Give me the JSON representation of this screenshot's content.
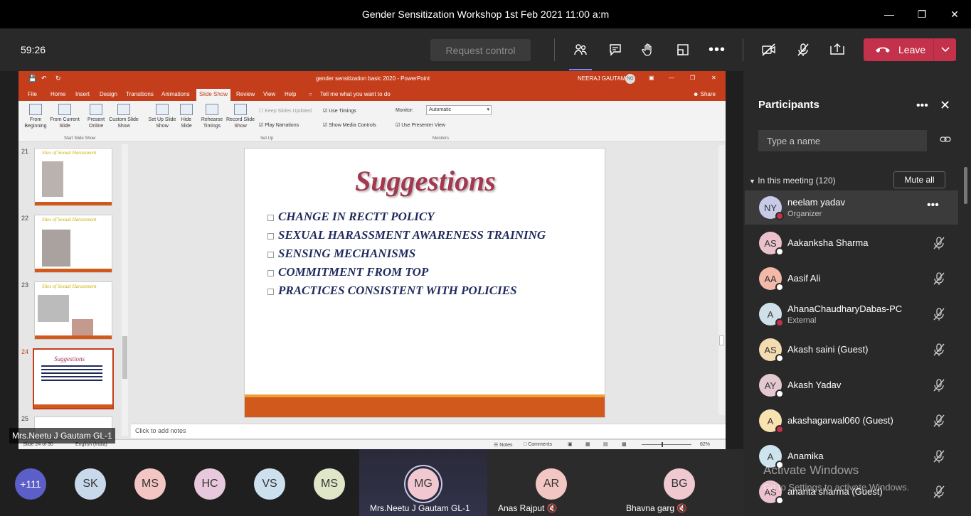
{
  "window": {
    "title": "Gender Sensitization Workshop 1st Feb 2021 11:00 a:m"
  },
  "toolbar": {
    "timer": "59:26",
    "request_control": "Request control",
    "leave": "Leave"
  },
  "powerpoint": {
    "doc_title": "gender sensitization basic 2020  -  PowerPoint",
    "user": "NEERAJ GAUTAM",
    "user_initials": "NG",
    "tabs": [
      "File",
      "Home",
      "Insert",
      "Design",
      "Transitions",
      "Animations",
      "Slide Show",
      "Review",
      "View",
      "Help"
    ],
    "tell_me": "Tell me what you want to do",
    "share": "Share",
    "ribbon": {
      "from_beginning": "From Beginning",
      "from_current": "From Current Slide",
      "present_online": "Present Online",
      "custom_show": "Custom Slide Show",
      "group_start": "Start Slide Show",
      "setup": "Set Up Slide Show",
      "hide": "Hide Slide",
      "rehearse": "Rehearse Timings",
      "record": "Record Slide Show",
      "keep_updated": "Keep Slides Updated",
      "play_narrations": "Play Narrations",
      "use_timings": "Use Timings",
      "show_media": "Show Media Controls",
      "group_setup": "Set Up",
      "monitor_label": "Monitor:",
      "monitor_value": "Automatic",
      "presenter_view": "Use Presenter View",
      "group_monitors": "Monitors"
    },
    "thumbnails": [
      {
        "num": "21",
        "title": "Sites of Sexual Harassment"
      },
      {
        "num": "22",
        "title": "Sites of Sexual Harassment"
      },
      {
        "num": "23",
        "title": "Sites of Sexual Harassment"
      },
      {
        "num": "24",
        "title": "Suggestions"
      },
      {
        "num": "25",
        "title": ""
      }
    ],
    "slide": {
      "title": "Suggestions",
      "bullets": [
        "CHANGE IN RECTT POLICY",
        "SEXUAL HARASSMENT AWARENESS TRAINING",
        "SENSING MECHANISMS",
        "COMMITMENT FROM TOP",
        "PRACTICES CONSISTENT WITH POLICIES"
      ]
    },
    "notes_placeholder": "Click to add notes",
    "status": {
      "slide": "Slide 24 of 30",
      "lang": "English (India)",
      "notes": "Notes",
      "comments": "Comments",
      "zoom": "82%"
    }
  },
  "presenter_tag": "Mrs.Neetu J Gautam GL-1",
  "participants": {
    "title": "Participants",
    "search_placeholder": "Type a name",
    "in_meeting": "In this meeting (120)",
    "mute_all": "Mute all",
    "list": [
      {
        "initials": "NY",
        "name": "neelam yadav",
        "sub": "Organizer",
        "color": "#c7cbe8",
        "status": "#c4314b"
      },
      {
        "initials": "AS",
        "name": "Aakanksha Sharma",
        "sub": "",
        "color": "#ebc2cc",
        "status": "#ffffff"
      },
      {
        "initials": "AA",
        "name": "Aasif Ali",
        "sub": "",
        "color": "#f2b9a8",
        "status": "#ffffff"
      },
      {
        "initials": "A",
        "name": "AhanaChaudharyDabas-PC",
        "sub": "External",
        "color": "#cfe0ea",
        "status": "#c4314b"
      },
      {
        "initials": "AS",
        "name": "Akash saini (Guest)",
        "sub": "",
        "color": "#f4dcb0",
        "status": "#ffffff"
      },
      {
        "initials": "AY",
        "name": "Akash Yadav",
        "sub": "",
        "color": "#e4c8d0",
        "status": "#ffffff"
      },
      {
        "initials": "A",
        "name": "akashagarwal060 (Guest)",
        "sub": "",
        "color": "#f8e2b0",
        "status": "#c4314b"
      },
      {
        "initials": "A",
        "name": "Anamika",
        "sub": "",
        "color": "#cde3ee",
        "status": "#ffffff"
      },
      {
        "initials": "AS",
        "name": "ananta sharma (Guest)",
        "sub": "",
        "color": "#ecc2cf",
        "status": "#ffffff"
      }
    ]
  },
  "watermark": {
    "line1": "Activate Windows",
    "line2": "Go to Settings to activate Windows."
  },
  "gallery": [
    {
      "initials": "+111",
      "name": "",
      "color": "#5b5fc7"
    },
    {
      "initials": "SK",
      "name": "",
      "color": "#c9d9ec"
    },
    {
      "initials": "MS",
      "name": "",
      "color": "#f3c6c3"
    },
    {
      "initials": "HC",
      "name": "",
      "color": "#e8c8dc"
    },
    {
      "initials": "VS",
      "name": "",
      "color": "#cde0ee"
    },
    {
      "initials": "MS",
      "name": "",
      "color": "#e0e6c8"
    },
    {
      "initials": "MG",
      "name": "Mrs.Neetu J Gautam GL-1",
      "color": "#f1c8d2"
    },
    {
      "initials": "AR",
      "name": "Anas Rajput",
      "color": "#f2c6c3"
    },
    {
      "initials": "BG",
      "name": "Bhavna garg",
      "color": "#efc8d0"
    }
  ]
}
